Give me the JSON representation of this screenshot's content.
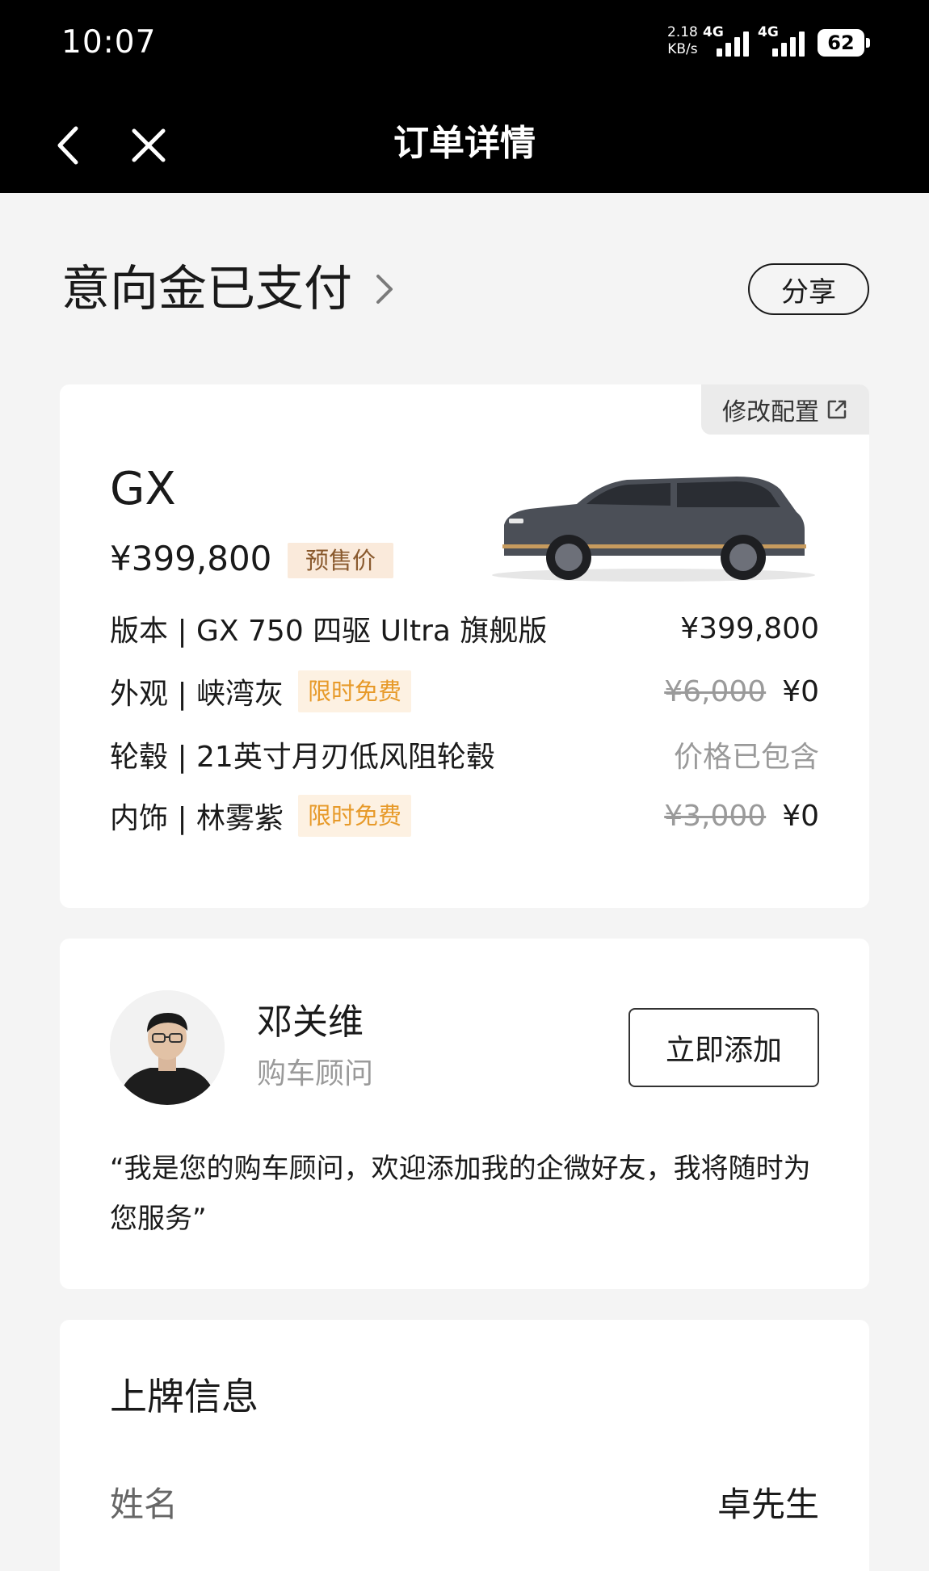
{
  "status_bar": {
    "time": "10:07",
    "net_speed_value": "2.18",
    "net_speed_unit": "KB/s",
    "signal1": "4G",
    "signal2": "4G",
    "battery": "62"
  },
  "nav": {
    "title": "订单详情",
    "back_icon": "chevron-left-icon",
    "close_icon": "close-icon"
  },
  "order_status": {
    "title": "意向金已支付",
    "share_label": "分享"
  },
  "vehicle": {
    "modify_label": "修改配置",
    "model": "GX",
    "price": "¥399,800",
    "price_tag": "预售价",
    "specs": [
      {
        "label": "版本 | GX 750 四驱 Ultra 旗舰版",
        "tag": "",
        "original": "",
        "price": "¥399,800"
      },
      {
        "label": "外观 | 峡湾灰",
        "tag": "限时免费",
        "original": "¥6,000",
        "price": "¥0"
      },
      {
        "label": "轮毂 | 21英寸月刃低风阻轮毂",
        "tag": "",
        "original": "",
        "price": "价格已包含"
      },
      {
        "label": "内饰 | 林雾紫",
        "tag": "限时免费",
        "original": "¥3,000",
        "price": "¥0"
      }
    ],
    "colors": {
      "free_tag_text": "#e79a2a",
      "free_tag_bg": "#fdf1e2",
      "presale_bg": "#faeadb"
    }
  },
  "advisor": {
    "name": "邓关维",
    "role": "购车顾问",
    "add_label": "立即添加",
    "quote": "“我是您的购车顾问，欢迎添加我的企微好友，我将随时为您服务”"
  },
  "plate_info": {
    "title": "上牌信息",
    "rows": [
      {
        "label": "姓名",
        "value": "卓先生"
      }
    ]
  }
}
